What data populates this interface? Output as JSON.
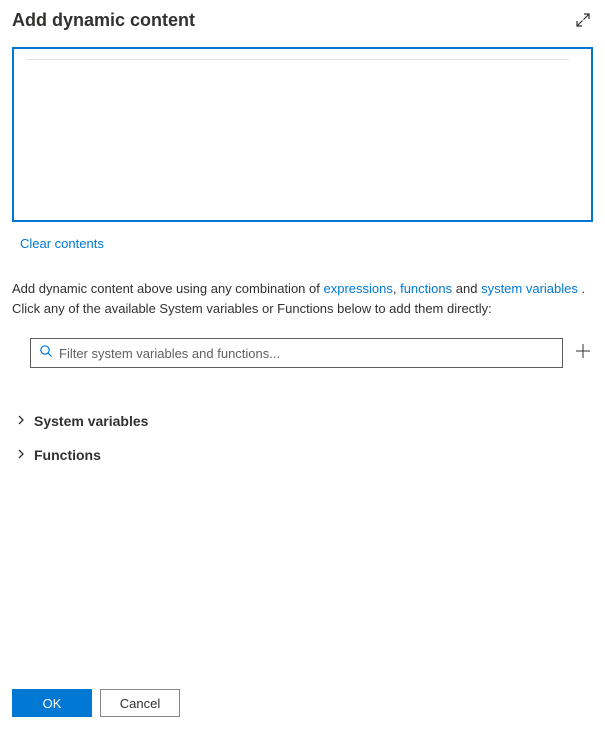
{
  "header": {
    "title": "Add dynamic content"
  },
  "editor": {
    "value": "",
    "clear_label": "Clear contents"
  },
  "help": {
    "prefix": "Add dynamic content above using any combination of ",
    "link_expressions": "expressions",
    "sep1": ", ",
    "link_functions": "functions",
    "sep2": " and ",
    "link_system_variables": "system variables",
    "suffix": " . Click any of the available System variables or Functions below to add them directly:"
  },
  "filter": {
    "placeholder": "Filter system variables and functions..."
  },
  "sections": {
    "system_variables": {
      "label": "System variables"
    },
    "functions": {
      "label": "Functions"
    }
  },
  "footer": {
    "ok_label": "OK",
    "cancel_label": "Cancel"
  }
}
